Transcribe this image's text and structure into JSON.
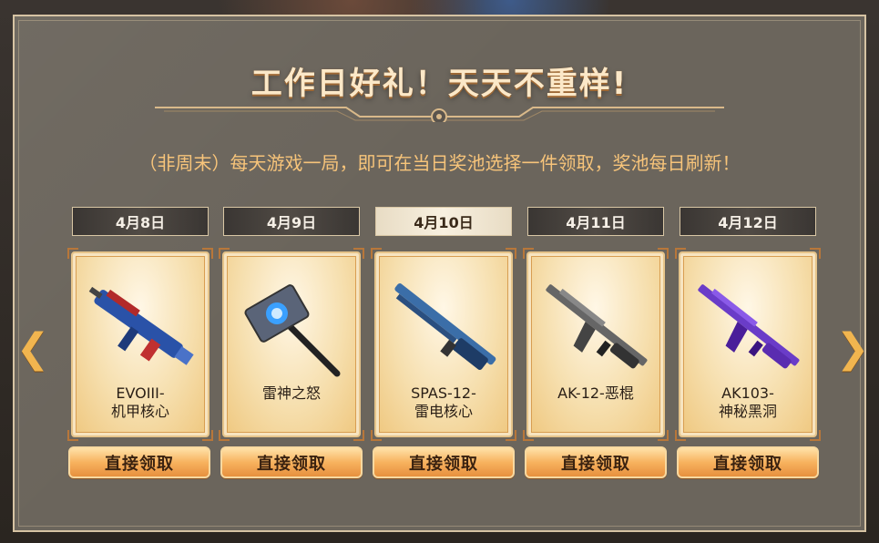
{
  "header": {
    "title": "工作日好礼！天天不重样!",
    "subtitle": "（非周末）每天游戏一局，即可在当日奖池选择一件领取，奖池每日刷新！"
  },
  "nav": {
    "prev_icon": "chevron-left-icon",
    "next_icon": "chevron-right-icon",
    "prev_glyph": "❮",
    "next_glyph": "❯"
  },
  "colors": {
    "accent": "#f7c47a",
    "button": "#f7b25e",
    "panel": "#6b655c"
  },
  "days": [
    {
      "date": "4月8日",
      "active": false,
      "name_line1": "EVOIII-",
      "name_line2": "机甲核心",
      "button": "直接领取",
      "icon": "smg-weapon-icon"
    },
    {
      "date": "4月9日",
      "active": false,
      "name_line1": "雷神之怒",
      "name_line2": "",
      "button": "直接领取",
      "icon": "hammer-weapon-icon"
    },
    {
      "date": "4月10日",
      "active": true,
      "name_line1": "SPAS-12-",
      "name_line2": "雷电核心",
      "button": "直接领取",
      "icon": "shotgun-weapon-icon"
    },
    {
      "date": "4月11日",
      "active": false,
      "name_line1": "AK-12-恶棍",
      "name_line2": "",
      "button": "直接领取",
      "icon": "rifle-weapon-icon"
    },
    {
      "date": "4月12日",
      "active": false,
      "name_line1": "AK103-",
      "name_line2": "神秘黑洞",
      "button": "直接领取",
      "icon": "purple-rifle-weapon-icon"
    }
  ]
}
